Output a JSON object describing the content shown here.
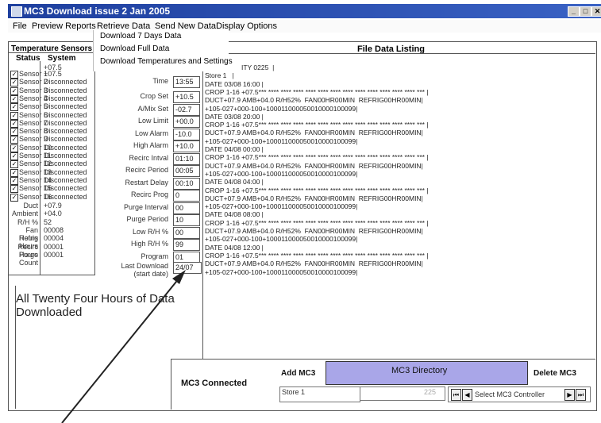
{
  "window": {
    "title": "MC3 Download issue 2 Jan 2005",
    "controls": [
      "_",
      "□",
      "✕"
    ]
  },
  "menu": [
    "File",
    "Preview Reports",
    "Retrieve Data",
    "Send New Data",
    "Display Options"
  ],
  "dropdown": [
    "Download 7 Days Data",
    "Download Full Data",
    "Download Temperatures and Settings"
  ],
  "left_panel": {
    "title": "Temperature Sensors",
    "col_status": "Status",
    "col_system": "System",
    "top_value": "+07.5",
    "sensors": [
      {
        "name": "Sensor 1",
        "value": "+07.5"
      },
      {
        "name": "Sensor 2",
        "value": "Disconnected"
      },
      {
        "name": "Sensor 3",
        "value": "Disconnected"
      },
      {
        "name": "Sensor 4",
        "value": "Disconnected"
      },
      {
        "name": "Sensor 5",
        "value": "Disconnected"
      },
      {
        "name": "Sensor 6",
        "value": "Disconnected"
      },
      {
        "name": "Sensor 7",
        "value": "Disconnected"
      },
      {
        "name": "Sensor 8",
        "value": "Disconnected"
      },
      {
        "name": "Sensor 9",
        "value": "Disconnected"
      },
      {
        "name": "Sensor 10",
        "value": "Disconnected"
      },
      {
        "name": "Sensor 11",
        "value": "Disconnected"
      },
      {
        "name": "Sensor 12",
        "value": "Disconnected"
      },
      {
        "name": "Sensor 13",
        "value": "Disconnected"
      },
      {
        "name": "Sensor 14",
        "value": "Disconnected"
      },
      {
        "name": "Sensor 15",
        "value": "Disconnected"
      },
      {
        "name": "Sensor 16",
        "value": "Disconnected"
      }
    ],
    "extras": [
      {
        "label": "Duct",
        "value": "+07.9"
      },
      {
        "label": "Ambient",
        "value": "+04.0"
      },
      {
        "label": "R/H %",
        "value": "52"
      },
      {
        "label": "Fan Hours",
        "value": "00008"
      },
      {
        "label": "Refrig Hours",
        "value": "00004"
      },
      {
        "label": "Recirc Hours",
        "value": "00001"
      },
      {
        "label": "Purge Count",
        "value": "00001"
      }
    ]
  },
  "settings": [
    {
      "label": "Time",
      "value": "13:55"
    },
    {
      "label": "Crop Set",
      "value": "+10.5"
    },
    {
      "label": "A/Mix Set",
      "value": "-02.7"
    },
    {
      "label": "Low Limit",
      "value": "+00.0"
    },
    {
      "label": "Low Alarm",
      "value": "-10.0"
    },
    {
      "label": "High Alarm",
      "value": "+10.0"
    },
    {
      "label": "Recirc Intval",
      "value": "01:10"
    },
    {
      "label": "Recirc Period",
      "value": "00:05"
    },
    {
      "label": "Restart Delay",
      "value": "00:10"
    },
    {
      "label": "Recirc Prog",
      "value": "0"
    },
    {
      "label": "Purge Interval",
      "value": "00"
    },
    {
      "label": "Purge Period",
      "value": "10"
    },
    {
      "label": "Low R/H %",
      "value": "00"
    },
    {
      "label": "High R/H %",
      "value": "99"
    },
    {
      "label": "Program",
      "value": "01"
    }
  ],
  "last_download": {
    "label1": "Last Download",
    "label2": "(start date)",
    "value": "24/07"
  },
  "message": "All Twenty Four Hours of Data Downloaded",
  "listing": {
    "title": "File Data Listing",
    "lines": [
      "ITY 0225  |",
      "Store 1   |",
      "DATE 03/08 16:00 |",
      "CROP 1-16 +07.5*** **** **** **** **** **** **** **** **** **** **** **** **** *** |",
      "DUCT+07.9 AMB+04.0 R/H52%  FAN00HR00MIN  REFRIG00HR00MIN|",
      "+105-027+000-100+100011000050010000100099|",
      "DATE 03/08 20:00 |",
      "CROP 1-16 +07.5*** **** **** **** **** **** **** **** **** **** **** **** **** *** |",
      "DUCT+07.9 AMB+04.0 R/H52%  FAN00HR00MIN  REFRIG00HR00MIN|",
      "+105-027+000-100+100011000050010000100099|",
      "DATE 04/08 00:00 |",
      "CROP 1-16 +07.5*** **** **** **** **** **** **** **** **** **** **** **** **** *** |",
      "DUCT+07.9 AMB+04.0 R/H52%  FAN00HR00MIN  REFRIG00HR00MIN|",
      "+105-027+000-100+100011000050010000100099|",
      "DATE 04/08 04:00 |",
      "CROP 1-16 +07.5*** **** **** **** **** **** **** **** **** **** **** **** **** *** |",
      "DUCT+07.9 AMB+04.0 R/H52%  FAN00HR00MIN  REFRIG00HR00MIN|",
      "+105-027+000-100+100011000050010000100099|",
      "DATE 04/08 08:00 |",
      "CROP 1-16 +07.5*** **** **** **** **** **** **** **** **** **** **** **** **** *** |",
      "DUCT+07.9 AMB+04.0 R/H52%  FAN00HR00MIN  REFRIG00HR00MIN|",
      "+105-027+000-100+100011000050010000100099|",
      "DATE 04/08 12:00 |",
      "CROP 1-16 +07.5*** **** **** **** **** **** **** **** **** **** **** **** **** *** |",
      "DUCT+07.9 AMB+04.0 R/H52%  FAN00HR00MIN  REFRIG00HR00MIN|",
      "+105-027+000-100+100011000050010000100099|"
    ]
  },
  "bottom": {
    "connected": "MC3 Connected",
    "add_button": "Add MC3",
    "directory_title": "MC3 Directory",
    "delete_button": "Delete MC3",
    "store_value": "Store 1",
    "id_value": "225",
    "select_label": "Select MC3 Controller"
  }
}
